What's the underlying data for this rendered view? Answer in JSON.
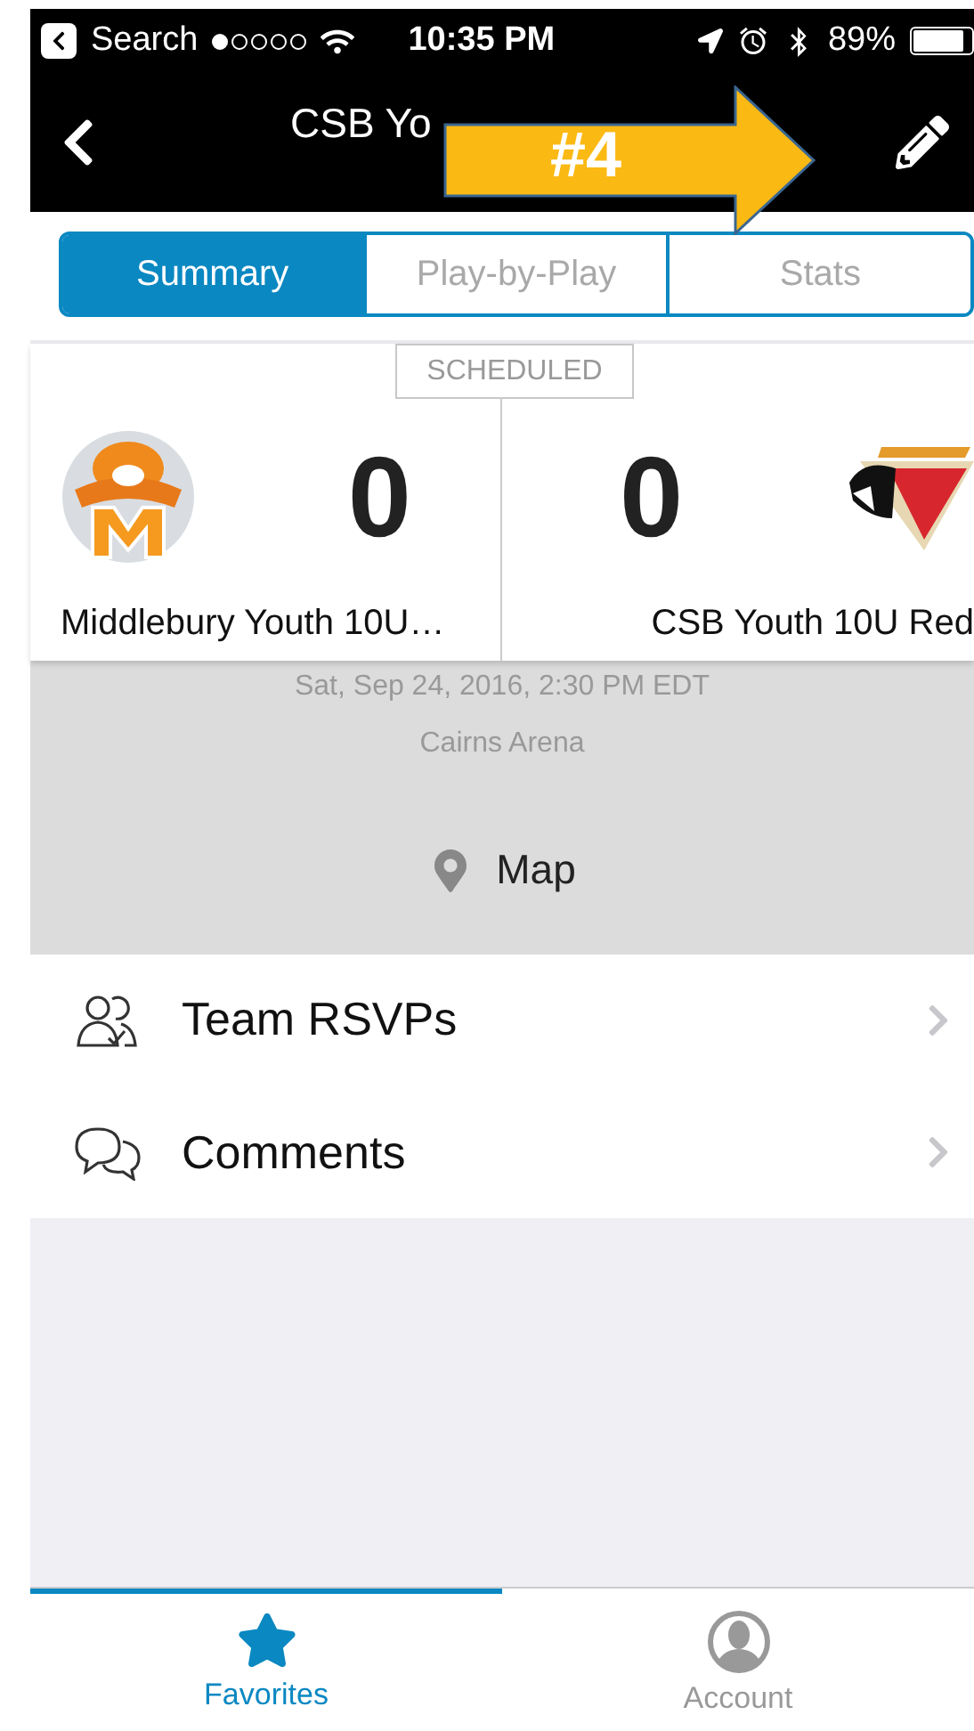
{
  "status_bar": {
    "back_label": "Search",
    "time": "10:35 PM",
    "battery": "89%"
  },
  "nav": {
    "title": "CSB Yo"
  },
  "annotation": {
    "label": "#4"
  },
  "segments": [
    {
      "label": "Summary",
      "selected": true
    },
    {
      "label": "Play-by-Play",
      "selected": false
    },
    {
      "label": "Stats",
      "selected": false
    }
  ],
  "game": {
    "status": "SCHEDULED",
    "home": {
      "name": "Middlebury Youth 10U…",
      "score": "0"
    },
    "away": {
      "name": "CSB Youth 10U Red",
      "score": "0"
    },
    "date": "Sat, Sep 24, 2016, 2:30 PM EDT",
    "venue": "Cairns Arena",
    "map_label": "Map"
  },
  "rows": [
    {
      "kind": "rsvp",
      "label": "Team RSVPs"
    },
    {
      "kind": "comments",
      "label": "Comments"
    }
  ],
  "tab_bar": [
    {
      "kind": "favorites",
      "label": "Favorites",
      "selected": true
    },
    {
      "kind": "account",
      "label": "Account",
      "selected": false
    }
  ]
}
